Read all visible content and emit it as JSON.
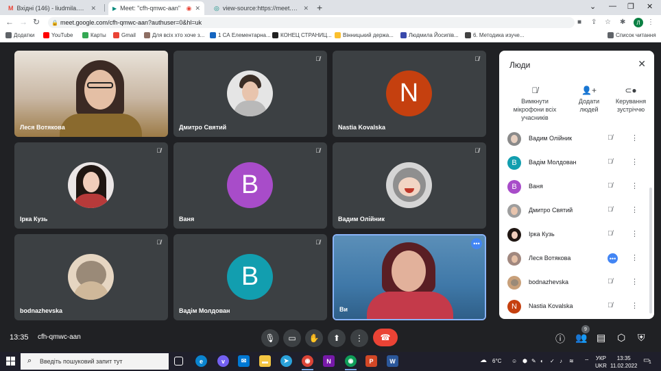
{
  "tabs": [
    {
      "title": "Вхідні (146) - liudmila.nakonechn",
      "favicon": "M",
      "color": "#ea4335"
    },
    {
      "title": "Meet: \"cfh-qmwc-aan\"",
      "favicon": "▶",
      "color": "#00897b"
    },
    {
      "title": "view-source:https://meet.googl",
      "favicon": "◎",
      "color": "#5f6368"
    }
  ],
  "address": {
    "url": "meet.google.com/cfh-qmwc-aan?authuser=0&hl=uk"
  },
  "bookmarks": [
    {
      "label": "Додатки",
      "color": "#5f6368"
    },
    {
      "label": "YouTube",
      "color": "#ff0000"
    },
    {
      "label": "Карты",
      "color": "#34a853"
    },
    {
      "label": "Gmail",
      "color": "#ea4335"
    },
    {
      "label": "Для всіх хто хоче з...",
      "color": "#8d6e63"
    },
    {
      "label": "1 СА Елементарна...",
      "color": "#1565c0"
    },
    {
      "label": "КОНЕЦ СТРАНИЦ...",
      "color": "#212121"
    },
    {
      "label": "Вінницький держа...",
      "color": "#fbc02d"
    },
    {
      "label": "Людмила Йосипів...",
      "color": "#3949ab"
    },
    {
      "label": "6. Методика изуче...",
      "color": "#424242"
    },
    {
      "label": "Список читання",
      "color": "#5f6368"
    }
  ],
  "tiles": [
    {
      "name": "Леся Вотякова",
      "type": "video",
      "bg": "#c7b9a8"
    },
    {
      "name": "Дмитро Святий",
      "type": "photo",
      "bg": "#d8d8d8"
    },
    {
      "name": "Nastia Kovalska",
      "type": "letter",
      "letter": "N",
      "bg": "#c5400f"
    },
    {
      "name": "Ірка Кузь",
      "type": "photo",
      "bg": "#b73a3a"
    },
    {
      "name": "Ваня",
      "type": "letter",
      "letter": "B",
      "bg": "#a84cc9"
    },
    {
      "name": "Вадим Олійник",
      "type": "photo",
      "bg": "#9a9a9a"
    },
    {
      "name": "bodnazhevska",
      "type": "photo",
      "bg": "#c8a07a"
    },
    {
      "name": "Вадім Молдован",
      "type": "letter",
      "letter": "B",
      "bg": "#129eaf"
    },
    {
      "name": "Ви",
      "type": "video",
      "bg": "#4f8fc0"
    }
  ],
  "panel": {
    "title": "Люди",
    "actions": [
      {
        "label": "Вимкнути мікрофони всіх учасників",
        "icon": "mic-off"
      },
      {
        "label": "Додати людей",
        "icon": "person-add"
      },
      {
        "label": "Керування зустріччю",
        "icon": "toggle"
      }
    ],
    "participants": [
      {
        "name": "Вадим Олійник",
        "letter": "",
        "bg": "#8a8a8a",
        "menu": false
      },
      {
        "name": "Вадім Молдован",
        "letter": "B",
        "bg": "#129eaf",
        "menu": false
      },
      {
        "name": "Ваня",
        "letter": "B",
        "bg": "#a84cc9",
        "menu": false
      },
      {
        "name": "Дмитро Святий",
        "letter": "",
        "bg": "#9e9e9e",
        "menu": false
      },
      {
        "name": "Ірка Кузь",
        "letter": "",
        "bg": "#b73a3a",
        "menu": false
      },
      {
        "name": "Леся Вотякова",
        "letter": "",
        "bg": "#a1887f",
        "menu": true
      },
      {
        "name": "bodnazhevska",
        "letter": "",
        "bg": "#c8a07a",
        "menu": false
      },
      {
        "name": "Nastia Kovalska",
        "letter": "N",
        "bg": "#c5400f",
        "menu": false
      }
    ]
  },
  "bottom": {
    "time": "13:35",
    "code": "cfh-qmwc-aan",
    "people_count": "9"
  },
  "taskbar": {
    "search_placeholder": "Введіть пошуковий запит тут",
    "temp": "6°C",
    "lang1": "УКР",
    "lang2": "UKR",
    "time": "13:35",
    "date": "11.02.2022",
    "notif": "1"
  }
}
